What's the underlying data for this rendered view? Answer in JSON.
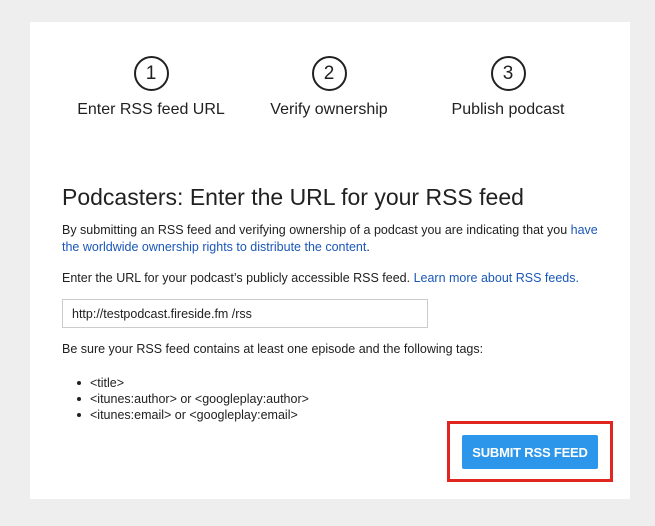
{
  "steps": [
    {
      "number": "1",
      "label": "Enter RSS feed URL"
    },
    {
      "number": "2",
      "label": "Verify ownership"
    },
    {
      "number": "3",
      "label": "Publish podcast"
    }
  ],
  "main": {
    "title": "Podcasters: Enter the URL for your RSS feed",
    "ownership_text": "By submitting an RSS feed and verifying ownership of a podcast you are indicating that you",
    "ownership_link": "have the worldwide ownership rights to distribute the content",
    "ownership_end": ".",
    "url_prompt": "Enter the URL for your podcast’s publicly accessible RSS feed.",
    "learn_more_link": "Learn more about RSS feeds.",
    "url_input": {
      "value": "http://testpodcast.fireside.fm /rss",
      "placeholder": ""
    },
    "requirements_text": "Be sure your RSS feed contains at least one episode and the following tags:",
    "tags": [
      "<title>",
      "<itunes:author> or <googleplay:author>",
      "<itunes:email> or <googleplay:email>"
    ],
    "submit_label": "SUBMIT RSS FEED"
  },
  "colors": {
    "link": "#1a57b8",
    "button": "#2c97ea",
    "highlight": "#e0261f"
  }
}
